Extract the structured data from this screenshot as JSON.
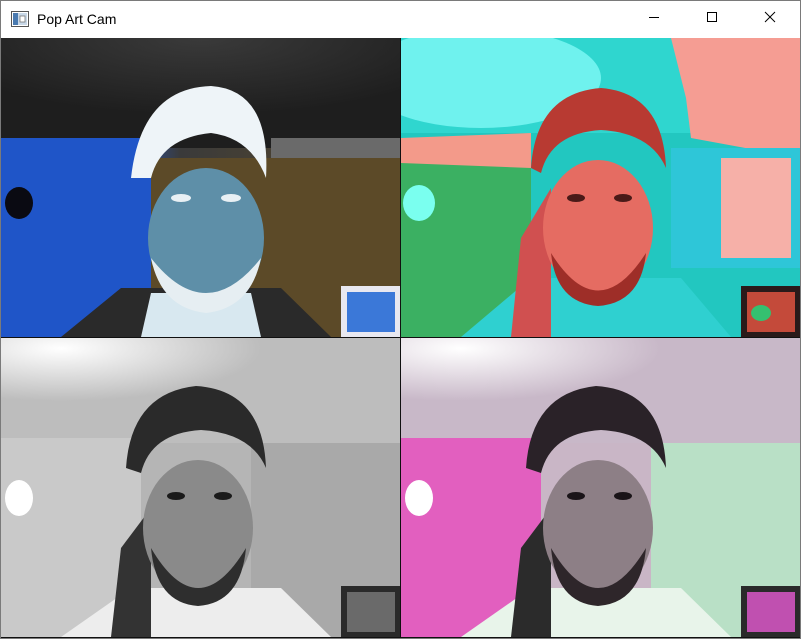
{
  "window": {
    "title": "Pop Art Cam",
    "icon": "app-window-icon",
    "controls": [
      "minimize-icon",
      "maximize-icon",
      "close-icon"
    ]
  },
  "panels": [
    {
      "position": "top-left",
      "filter": "inverted",
      "accent": "#3a7bd5"
    },
    {
      "position": "top-right",
      "filter": "posterized-teal-salmon",
      "accent": "#2fd6c8"
    },
    {
      "position": "bottom-left",
      "filter": "grayscale",
      "accent": "#9a9a9a"
    },
    {
      "position": "bottom-right",
      "filter": "tinted-pink-green",
      "accent": "#e060c0"
    }
  ]
}
